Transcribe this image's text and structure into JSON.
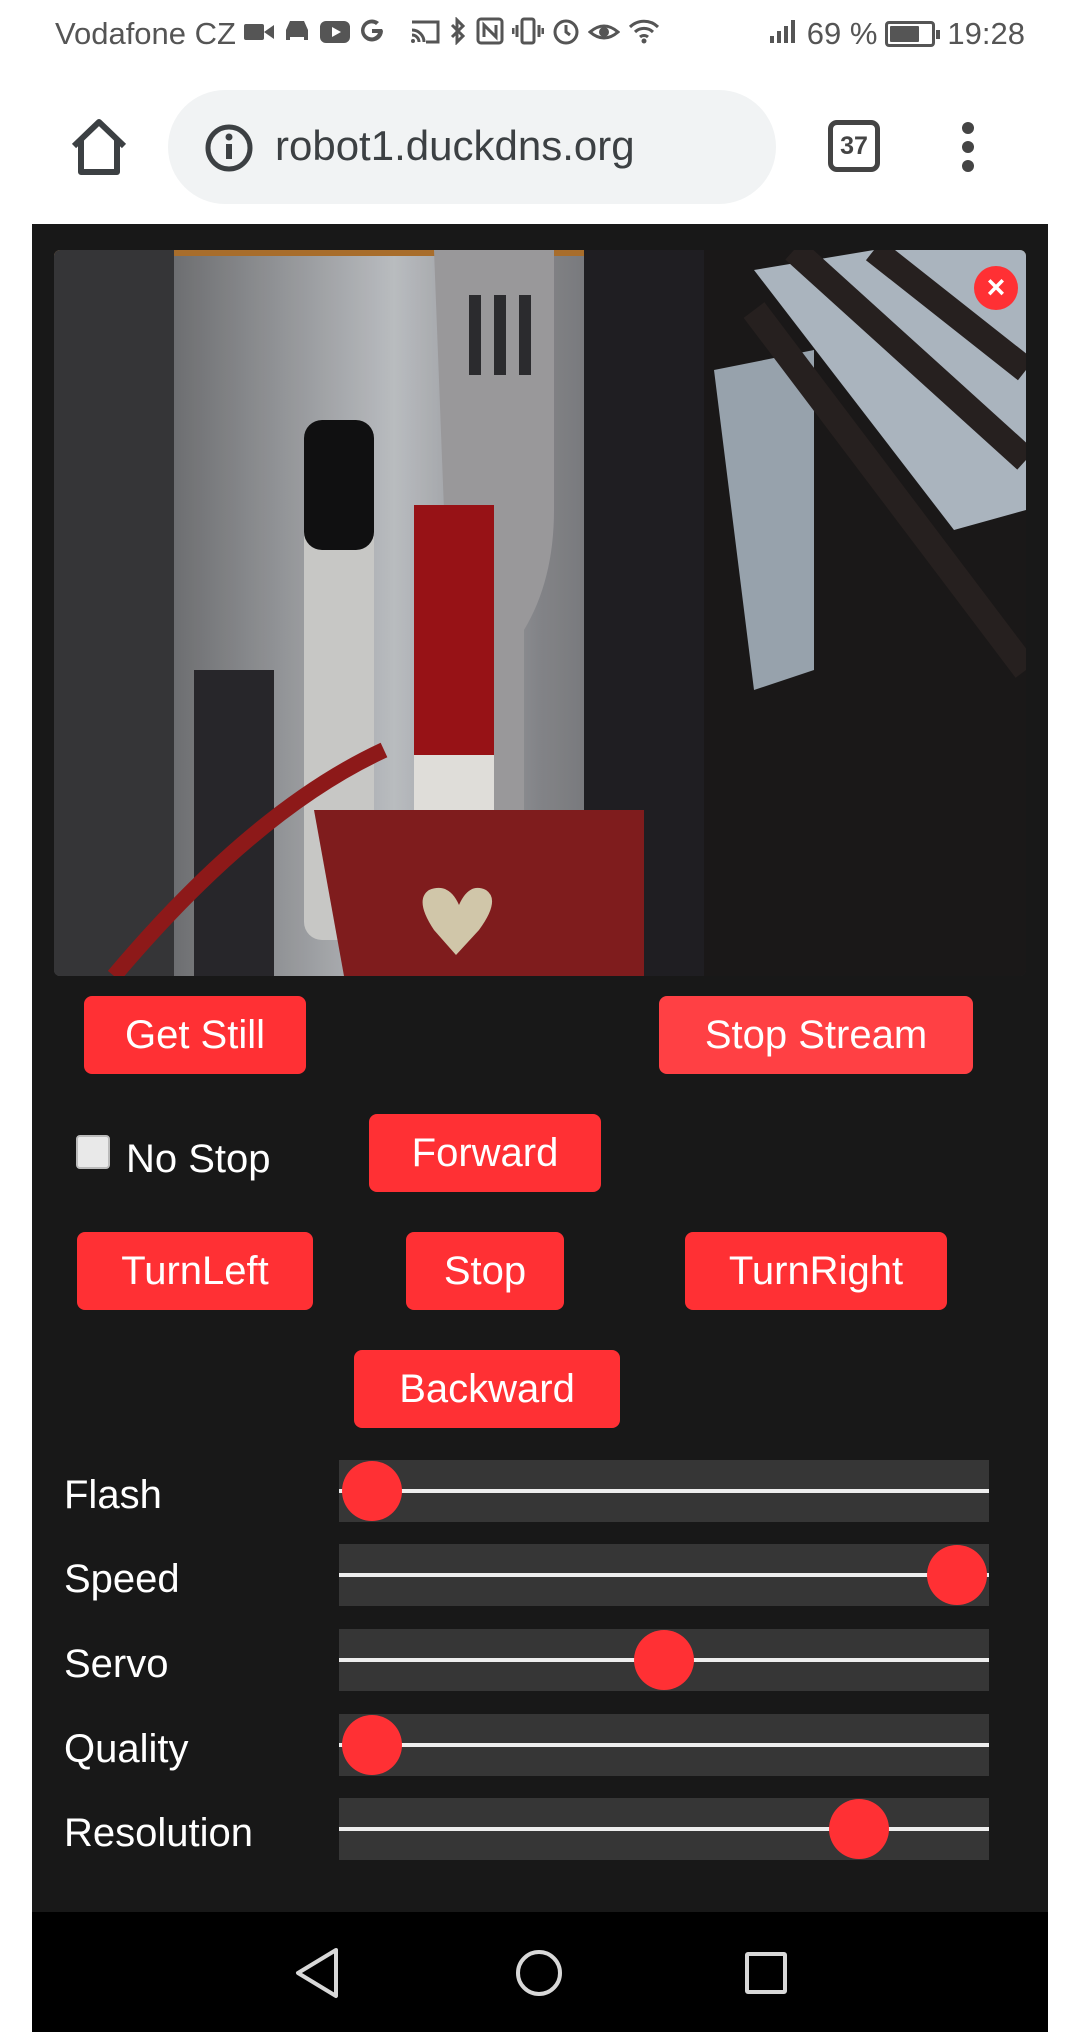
{
  "status_bar": {
    "carrier": "Vodafone CZ",
    "battery": "69 %",
    "battery_fraction": 0.69,
    "time": "19:28"
  },
  "browser": {
    "url": "robot1.duckdns.org",
    "tab_count": "37"
  },
  "stream": {
    "close_label": "×"
  },
  "controls": {
    "get_still": "Get Still",
    "stop_stream": "Stop Stream",
    "no_stop": "No Stop",
    "no_stop_checked": false,
    "forward": "Forward",
    "turn_left": "TurnLeft",
    "stop": "Stop",
    "turn_right": "TurnRight",
    "backward": "Backward"
  },
  "sliders": [
    {
      "label": "Flash",
      "value_fraction": 0.05
    },
    {
      "label": "Speed",
      "value_fraction": 0.95
    },
    {
      "label": "Servo",
      "value_fraction": 0.5
    },
    {
      "label": "Quality",
      "value_fraction": 0.05
    },
    {
      "label": "Resolution",
      "value_fraction": 0.8
    }
  ],
  "colors": {
    "accent": "#ff3034",
    "page_background": "#181818"
  }
}
